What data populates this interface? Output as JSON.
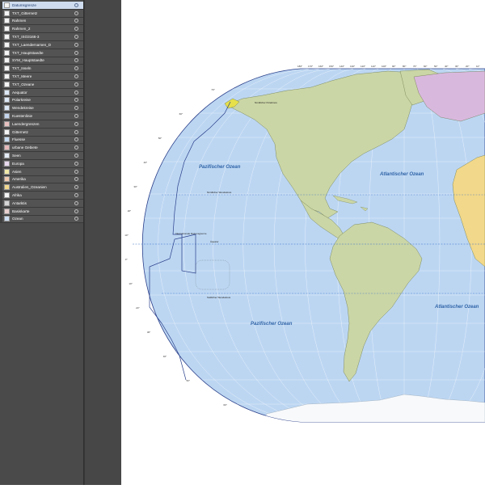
{
  "layers": [
    {
      "name": "Datumsgrenze",
      "swatch": "#f4f4f4",
      "selected": true
    },
    {
      "name": "TXT_Gitternetz",
      "swatch": "#f4f4f4"
    },
    {
      "name": "Rahmen",
      "swatch": "#f4f4f4"
    },
    {
      "name": "Rahmen_2",
      "swatch": "#f4f4f4"
    },
    {
      "name": "TXT_ISO3166-3",
      "swatch": "#f4f4f4"
    },
    {
      "name": "TXT_Laendernamen_D",
      "swatch": "#f4f4f4"
    },
    {
      "name": "TXT_Hauptstaedte",
      "swatch": "#f4f4f4"
    },
    {
      "name": "SYM_Hauptstaedte",
      "swatch": "#f4f4f4"
    },
    {
      "name": "TXT_Inseln",
      "swatch": "#f4f4f4"
    },
    {
      "name": "TXT_Meere",
      "swatch": "#f4f4f4"
    },
    {
      "name": "TXT_Ozeane",
      "swatch": "#f4f4f4"
    },
    {
      "name": "Aequator",
      "swatch": "#dde8f6"
    },
    {
      "name": "Polarkreise",
      "swatch": "#dde8f6"
    },
    {
      "name": "Wendekreise",
      "swatch": "#dde8f6"
    },
    {
      "name": "Kuestenlinie",
      "swatch": "#c4d6ee"
    },
    {
      "name": "Laendergrenzen",
      "swatch": "#e8c0c0"
    },
    {
      "name": "Gitternetz",
      "swatch": "#f4f4f4"
    },
    {
      "name": "Fluesse",
      "swatch": "#c7dcf2"
    },
    {
      "name": "urbane Gebiete",
      "swatch": "#e7b9b9"
    },
    {
      "name": "Seen",
      "swatch": "#e4ecf7"
    },
    {
      "name": "Europa",
      "swatch": "#e8d9ee"
    },
    {
      "name": "Asien",
      "swatch": "#f1e9a8"
    },
    {
      "name": "Amerika",
      "swatch": "#f0c9b0"
    },
    {
      "name": "Australien_Ozeanien",
      "swatch": "#f2d88e"
    },
    {
      "name": "Afrika",
      "swatch": "#f4f4f4"
    },
    {
      "name": "Antarktis",
      "swatch": "#d6d6d6"
    },
    {
      "name": "Basiskarte",
      "swatch": "#e9d0d0"
    },
    {
      "name": "Ozean",
      "swatch": "#cfe0f4"
    }
  ],
  "map": {
    "ocean_labels": {
      "pacific_north": "Pazifischer Ozean",
      "pacific_south": "Pazifischer Ozean",
      "atlantic_north": "Atlantischer Ozean",
      "atlantic_south": "Atlantischer Ozean"
    },
    "line_labels": {
      "dateline": "Internationale Datumsgrenze",
      "equator": "Äquator",
      "tropic_cancer": "Nördlicher Wendekreis",
      "tropic_capricorn": "Südlicher Wendekreis",
      "arctic": "Nördlicher Polarkreis"
    },
    "top_degrees": [
      "180°",
      "170°",
      "160°",
      "150°",
      "140°",
      "130°",
      "120°",
      "110°",
      "100°",
      "90°",
      "80°",
      "70°",
      "60°",
      "50°",
      "40°",
      "30°",
      "20°",
      "10°"
    ],
    "left_degrees": [
      "70°",
      "60°",
      "50°",
      "40°",
      "30°",
      "20°",
      "10°",
      "0°",
      "10°",
      "20°",
      "30°",
      "40°",
      "50°",
      "60°"
    ],
    "colors": {
      "ocean": "#bcd6f2",
      "land": "#cbd6a6",
      "europe": "#d9b8de",
      "africa": "#f2d88a",
      "antarctica": "#f7f9fb",
      "dateline": "#2a3f8a",
      "equator": "#3a72c8"
    }
  }
}
